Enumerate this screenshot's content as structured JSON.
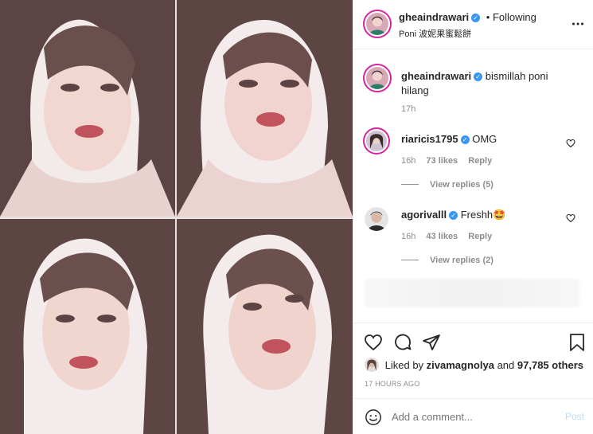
{
  "header": {
    "username": "gheaindrawari",
    "separator": "•",
    "follow_status": "Following",
    "location": "Poni 波妮果蜜鬆餅",
    "more_icon": "more-horizontal-icon"
  },
  "caption": {
    "username": "gheaindrawari",
    "text_line1": "bismillah poni",
    "text_line2": "hilang",
    "time": "17h"
  },
  "comments": [
    {
      "username": "riaricis1795",
      "text": "OMG",
      "time": "16h",
      "likes": "73 likes",
      "reply_label": "Reply",
      "view_replies": "View replies (5)"
    },
    {
      "username": "agorivalll",
      "text": "Freshh",
      "emoji": "🤩",
      "time": "16h",
      "likes": "43 likes",
      "reply_label": "Reply",
      "view_replies": "View replies (2)"
    }
  ],
  "actions": {
    "liked_by_prefix": "Liked by",
    "liked_by_user": "zivamagnolya",
    "liked_by_and": "and",
    "liked_by_count": "97,785 others",
    "timestamp": "17 HOURS AGO"
  },
  "comment_box": {
    "placeholder": "Add a comment...",
    "post_label": "Post"
  },
  "colors": {
    "accent": "#3897f0",
    "ring": "#d6249f",
    "text": "#262626",
    "muted": "#8e8e8e"
  }
}
